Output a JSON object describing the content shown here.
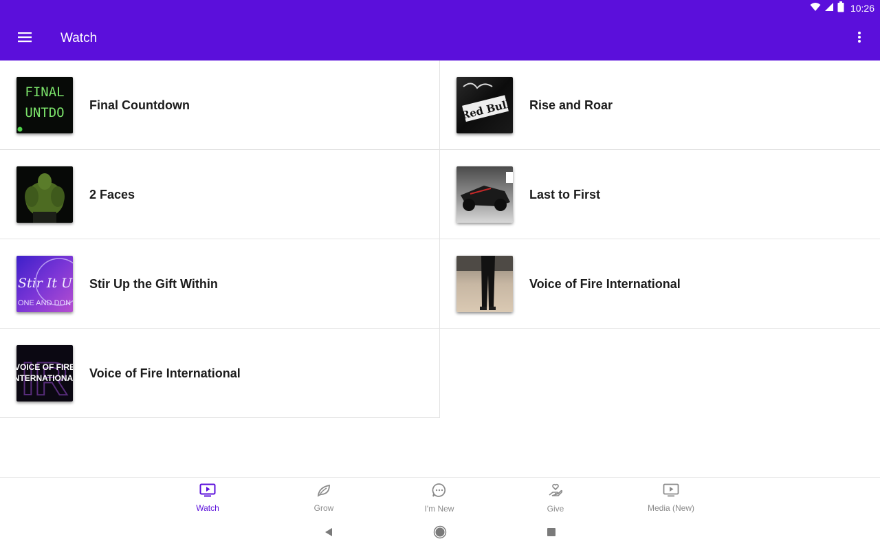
{
  "status_bar": {
    "time": "10:26",
    "icons": [
      "wifi-icon",
      "signal-icon",
      "battery-icon"
    ]
  },
  "app_bar": {
    "title": "Watch",
    "menu_icon": "hamburger-menu-icon",
    "overflow_icon": "more-vert-icon"
  },
  "colors": {
    "primary": "#5b0fdb",
    "nav_inactive": "#8a8a8a",
    "title_text": "#1c1c1c"
  },
  "items": [
    {
      "title": "Final Countdown",
      "thumb_text": [
        "FINAL",
        "UNTDO"
      ]
    },
    {
      "title": "Rise and Roar",
      "thumb_text": [
        "Red Bull"
      ]
    },
    {
      "title": "2 Faces"
    },
    {
      "title": "Last to First"
    },
    {
      "title": "Stir Up the Gift Within",
      "thumb_text": [
        "Stir It Up",
        "ONE AND DON"
      ]
    },
    {
      "title": "Voice of Fire International"
    },
    {
      "title": "Voice of Fire International",
      "thumb_text": [
        "VOICE OF FIRE",
        "INTERNATIONAL",
        "IR"
      ]
    }
  ],
  "bottom_nav": [
    {
      "label": "Watch",
      "icon": "tv-play-icon",
      "active": true
    },
    {
      "label": "Grow",
      "icon": "leaf-icon",
      "active": false
    },
    {
      "label": "I'm New",
      "icon": "chat-bubble-icon",
      "active": false
    },
    {
      "label": "Give",
      "icon": "heart-hand-icon",
      "active": false
    },
    {
      "label": "Media (New)",
      "icon": "tv-play-icon",
      "active": false
    }
  ],
  "system_nav": [
    "back-icon",
    "home-icon",
    "recents-icon"
  ]
}
